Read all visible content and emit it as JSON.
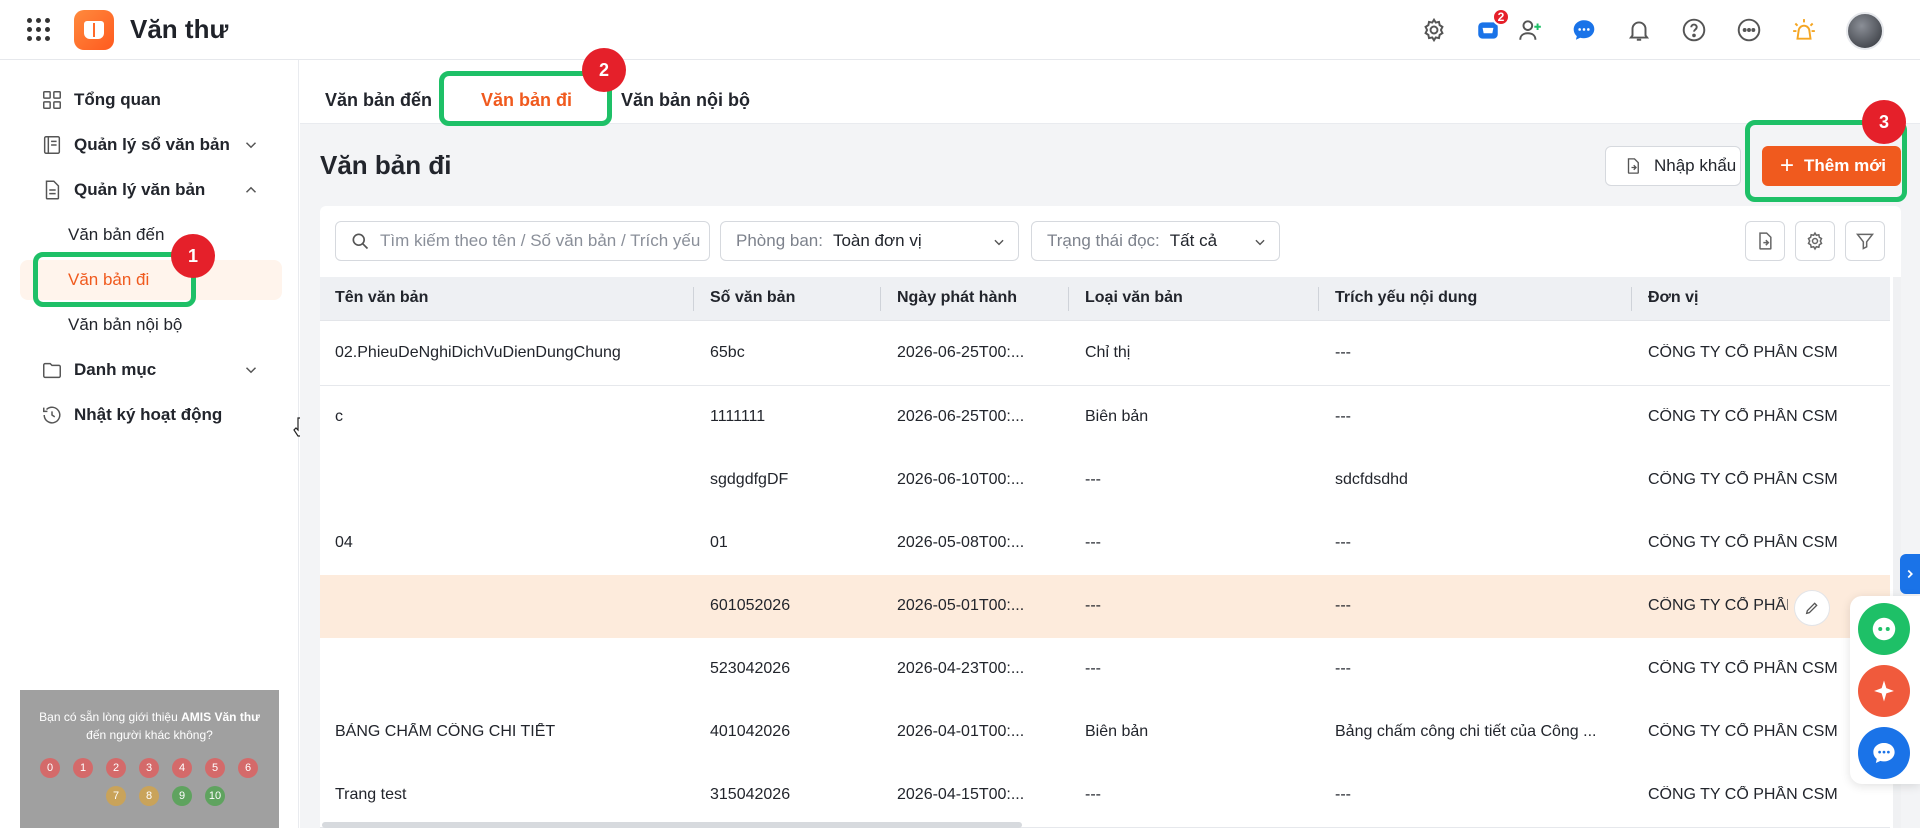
{
  "app": {
    "title": "Văn thư",
    "notification_count": "2",
    "accent": "#f05a1e"
  },
  "sidebar": {
    "items": [
      {
        "label": "Tổng quan",
        "icon": "grid-icon"
      },
      {
        "label": "Quản lý sổ văn bản",
        "icon": "book-icon",
        "expanded": false
      },
      {
        "label": "Quản lý văn bản",
        "icon": "document-icon",
        "expanded": true
      },
      {
        "label": "Danh mục",
        "icon": "folder-icon",
        "expanded": false
      },
      {
        "label": "Nhật ký hoạt động",
        "icon": "history-icon"
      }
    ],
    "subitems": [
      {
        "label": "Văn bản đến"
      },
      {
        "label": "Văn bản đi",
        "active": true
      },
      {
        "label": "Văn bản nội bộ"
      }
    ],
    "survey": {
      "text_prefix": "Bạn có sẵn lòng giới thiệu",
      "text_bold": "AMIS Văn thư",
      "text_suffix": "đến người khác không?",
      "scores": [
        "0",
        "1",
        "2",
        "3",
        "4",
        "5",
        "6",
        "7",
        "8",
        "9",
        "10"
      ]
    }
  },
  "tabs": [
    {
      "label": "Văn bản đến"
    },
    {
      "label": "Văn bản đi",
      "active": true
    },
    {
      "label": "Văn bản nội bộ"
    }
  ],
  "page": {
    "title": "Văn bản đi",
    "import_label": "Nhập khẩu",
    "add_label": "Thêm mới"
  },
  "filters": {
    "search_placeholder": "Tìm kiếm theo tên / Số văn bản / Trích yếu",
    "department_label": "Phòng ban:",
    "department_value": "Toàn đơn vị",
    "read_status_label": "Trạng thái đọc:",
    "read_status_value": "Tất cả"
  },
  "table": {
    "columns": [
      "Tên văn bản",
      "Số văn bản",
      "Ngày phát hành",
      "Loại văn bản",
      "Trích yếu nội dung",
      "Đơn vị"
    ],
    "rows": [
      [
        "02.PhieuDeNghiDichVuDienDungChung",
        "65bc",
        "2026-06-25T00:...",
        "Chỉ thị",
        "---",
        "CÔNG TY CỔ PHẦN CSM"
      ],
      [
        "c",
        "1111111",
        "2026-06-25T00:...",
        "Biên bản",
        "---",
        "CÔNG TY CỔ PHẦN CSM"
      ],
      [
        "",
        "sgdgdfgDF",
        "2026-06-10T00:...",
        "---",
        "sdcfdsdhd",
        "CÔNG TY CỔ PHẦN CSM"
      ],
      [
        "04",
        "01",
        "2026-05-08T00:...",
        "---",
        "---",
        "CÔNG TY CỔ PHẦN CSM"
      ],
      [
        "",
        "601052026",
        "2026-05-01T00:...",
        "---",
        "---",
        "CÔNG TY CỔ PHẦN CSM"
      ],
      [
        "",
        "523042026",
        "2026-04-23T00:...",
        "---",
        "---",
        "CÔNG TY CỔ PHẦN CSM"
      ],
      [
        "BẢNG CHẤM CÔNG CHI TIẾT",
        "401042026",
        "2026-04-01T00:...",
        "Biên bản",
        "Bảng chấm công chi tiết của Công ...",
        "CÔNG TY CỔ PHẦN CSM"
      ],
      [
        "Trang test",
        "315042026",
        "2026-04-15T00:...",
        "---",
        "---",
        "CÔNG TY CỔ PHẦN CSM"
      ]
    ],
    "highlighted_row": 4
  },
  "annotations": {
    "steps": [
      "1",
      "2",
      "3"
    ],
    "highlight_color": "#1ec067",
    "marker_color": "#e5202a"
  }
}
